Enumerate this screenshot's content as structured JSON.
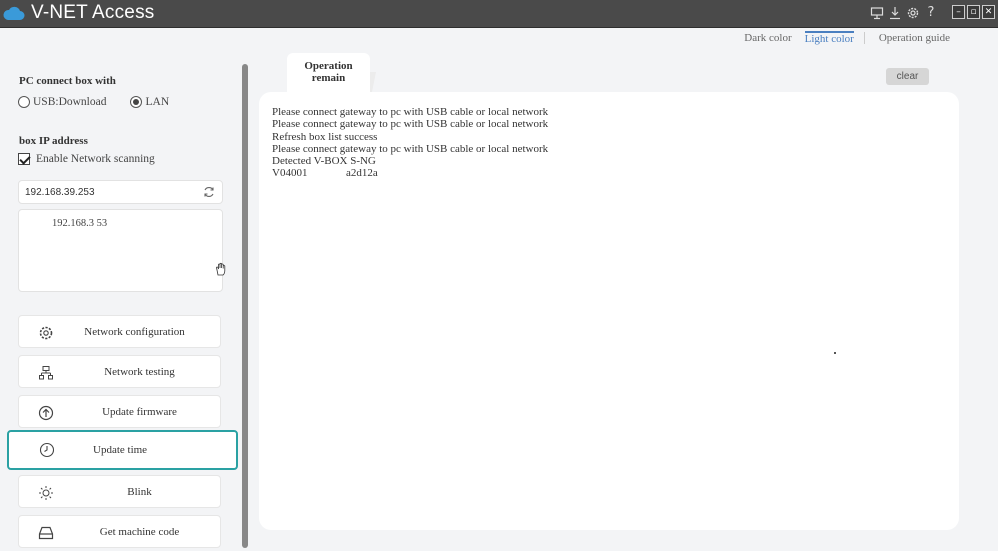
{
  "app": {
    "title": "V-NET Access"
  },
  "titlebar_icons": [
    "monitor-icon",
    "download-icon",
    "settings-icon",
    "help-icon"
  ],
  "window_buttons": [
    "minimize",
    "maximize",
    "close"
  ],
  "theme": {
    "dark": "Dark color",
    "light": "Light color",
    "guide": "Operation guide"
  },
  "connect": {
    "title": "PC connect box with",
    "options": [
      {
        "label": "USB:Download",
        "selected": false
      },
      {
        "label": "LAN",
        "selected": true
      }
    ]
  },
  "box_ip": {
    "title": "box IP address",
    "scan_label": "Enable Network scanning",
    "scan_checked": true,
    "value": "192.168.39.253",
    "list": [
      "192.168.3   53"
    ]
  },
  "actions": [
    {
      "label": "Network configuration",
      "icon": "gear-icon"
    },
    {
      "label": "Network testing",
      "icon": "network-icon"
    },
    {
      "label": "Update firmware",
      "icon": "upload-icon"
    },
    {
      "label": "Update time",
      "icon": "clock-icon",
      "selected": true
    },
    {
      "label": "Blink",
      "icon": "sun-icon"
    },
    {
      "label": "Get machine code",
      "icon": "tray-icon"
    }
  ],
  "tab": {
    "line1": "Operation",
    "line2": "remain"
  },
  "clear_label": "clear",
  "log": [
    "Please connect gateway to pc with USB cable or local network",
    "Please connect gateway to pc with USB cable or local network",
    "Refresh box list success",
    "Please connect gateway to pc with USB cable or local network",
    "Detected V-BOX S-NG",
    "V04001              a2d12a"
  ],
  "colors": {
    "titlebar": "#4a4a4a",
    "accent": "#2aa1a3",
    "link": "#4a7fc0",
    "cloud": "#3a9ad9"
  }
}
